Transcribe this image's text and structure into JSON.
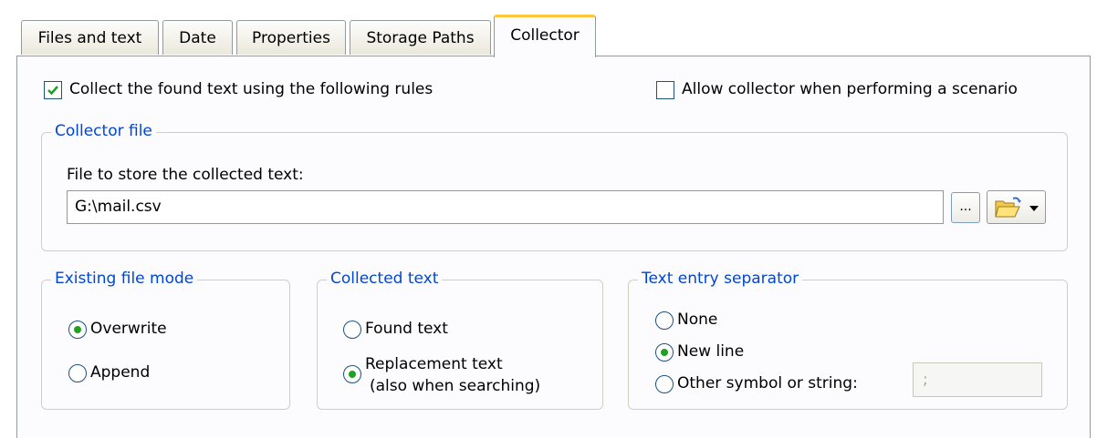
{
  "tabs": [
    {
      "label": "Files and text"
    },
    {
      "label": "Date"
    },
    {
      "label": "Properties"
    },
    {
      "label": "Storage Paths"
    },
    {
      "label": "Collector"
    }
  ],
  "active_tab": "Collector",
  "collect_rules": {
    "label": "Collect the found text using the following rules",
    "checked": true
  },
  "allow_scenario": {
    "label": "Allow collector when performing a scenario",
    "checked": false
  },
  "collector_file": {
    "legend": "Collector file",
    "file_label": "File to store the collected text:",
    "file_value": "G:\\mail.csv",
    "browse_label": "..."
  },
  "existing_mode": {
    "legend": "Existing file mode",
    "options": [
      {
        "label": "Overwrite",
        "selected": true
      },
      {
        "label": "Append",
        "selected": false
      }
    ]
  },
  "collected_text": {
    "legend": "Collected text",
    "options": [
      {
        "label": "Found text",
        "selected": false
      },
      {
        "label": "Replacement text",
        "sublabel": "(also when searching)",
        "selected": true
      }
    ]
  },
  "separator": {
    "legend": "Text entry separator",
    "options": [
      {
        "label": "None",
        "selected": false
      },
      {
        "label": "New line",
        "selected": true
      },
      {
        "label": "Other symbol or string:",
        "selected": false
      }
    ],
    "other_value": ";"
  },
  "colors": {
    "legend": "#0046d5",
    "active_tab_accent": "#ffc83c",
    "radio_dot": "#21a121"
  }
}
